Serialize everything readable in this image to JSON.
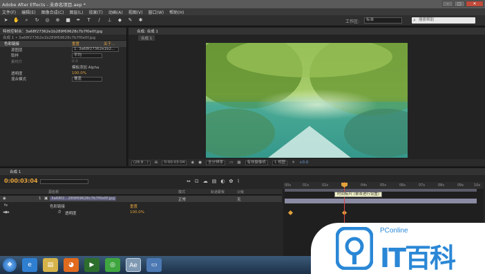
{
  "window": {
    "title": "Adobe After Effects - 未命名项目.aep *"
  },
  "menu": [
    "文件(F)",
    "编辑(E)",
    "图像合成(C)",
    "图层(L)",
    "效果(T)",
    "动画(A)",
    "视图(V)",
    "窗口(W)",
    "帮助(H)"
  ],
  "toolbar": {
    "workspace_label": "工作区:",
    "workspace_value": "标准",
    "search_placeholder": "搜索帮助"
  },
  "effects_panel": {
    "tab": "特效控制台：3a68f27362e1b289f69628c7b7f0e0f.jpg",
    "subtitle": "合成 1 • 3a68f27362e1b289f69628c7b7f0e0f.jpg",
    "effect_name": "色彩链接",
    "reset": "重置",
    "about": "关于...",
    "rows": [
      {
        "label": "源图层",
        "value": "1. 3a68f27362e1b2..."
      },
      {
        "label": "取样",
        "value": "平均"
      },
      {
        "label": "素材片",
        "value": "0.0"
      },
      {
        "label": "",
        "value": "模板添加 Alpha"
      },
      {
        "label": "透明度",
        "value": "100.0%"
      },
      {
        "label": "混合模式",
        "value": "覆盖"
      }
    ]
  },
  "composition": {
    "tab": "合成: 合成 1",
    "sub_tab": "合成 1",
    "zoom": "(28.8...)",
    "timecode": "0:00:03:04",
    "resolution": "全分辨率",
    "camera": "有效摄像机",
    "views": "1 视图",
    "exposure": "+0.0"
  },
  "timeline": {
    "tab": "合成 1",
    "time": "0:00:03:04",
    "col_name": "源名称",
    "col_mode": "模式",
    "col_trkmat": "轨道蒙板",
    "col_parent": "父级",
    "layer": {
      "index": "1",
      "name": "3a68f2...289f69628c7b7f0e0f.jpg",
      "mode": "正常",
      "parent": "无"
    },
    "effect_row": {
      "label": "色彩链接",
      "reset": "重置"
    },
    "prop_row": {
      "label": "透明度",
      "value": "100.0%"
    },
    "ruler": [
      "00s",
      "01s",
      "02s",
      "03s",
      "04s",
      "05s",
      "06s",
      "07s",
      "08s",
      "09s",
      "10s"
    ],
    "tooltip": "时间标尺 (单击进行设置)"
  },
  "taskbar": {
    "ae_label": "Ae"
  },
  "watermark": {
    "brand": "PConline",
    "big_text": "IT百科"
  },
  "colors": {
    "accent": "#e2a13a",
    "watermark_blue": "#2a87d6"
  }
}
